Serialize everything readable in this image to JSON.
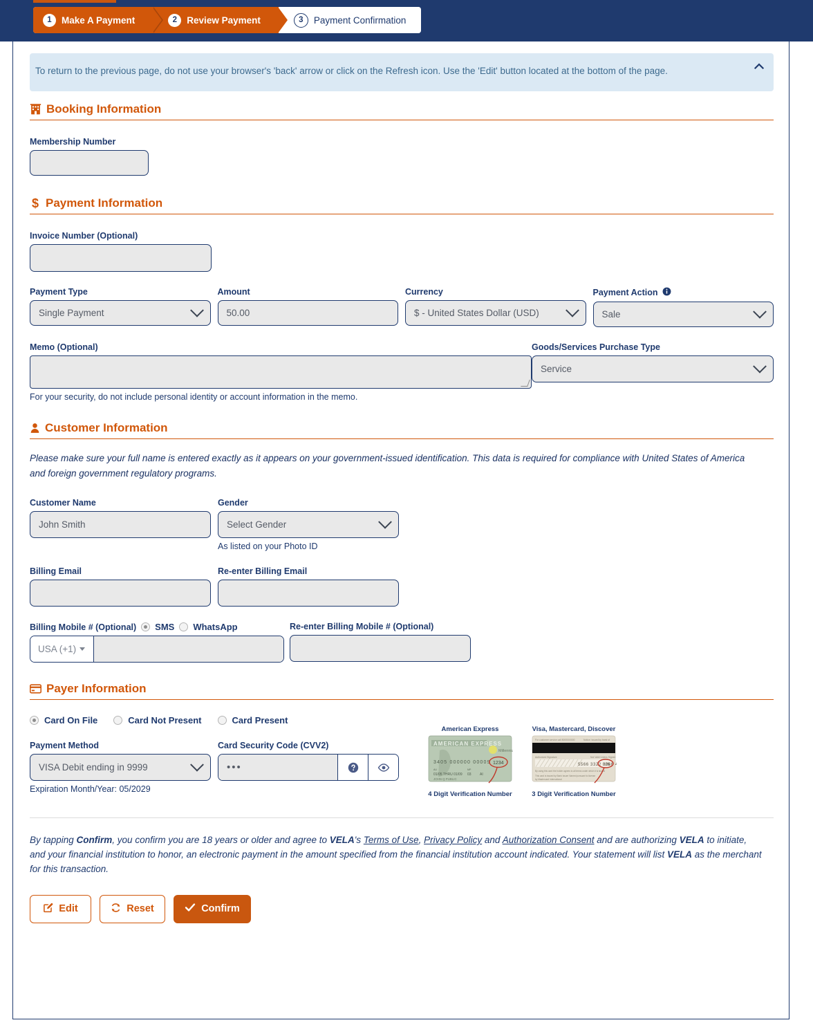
{
  "wizard": {
    "steps": [
      {
        "num": "1",
        "label": "Make A Payment",
        "state": "done"
      },
      {
        "num": "2",
        "label": "Review Payment",
        "state": "done"
      },
      {
        "num": "3",
        "label": "Payment Confirmation",
        "state": "current"
      }
    ]
  },
  "alert": {
    "text": "To return to the previous page, do not use your browser's 'back' arrow or click on the Refresh icon. Use the 'Edit' button located at the bottom of the page.",
    "collapse_icon": "chevron-up-icon"
  },
  "booking": {
    "heading": "Booking Information",
    "icon": "building-icon",
    "membership_label": "Membership Number",
    "membership_value": ""
  },
  "payment": {
    "heading": "Payment Information",
    "icon": "dollar-icon",
    "invoice_label": "Invoice Number (Optional)",
    "invoice_value": "",
    "payment_type_label": "Payment Type",
    "payment_type_value": "Single Payment",
    "amount_label": "Amount",
    "amount_value": "50.00",
    "currency_label": "Currency",
    "currency_value": "$ - United States Dollar (USD)",
    "payment_action_label": "Payment Action",
    "payment_action_info_icon": "info-icon",
    "payment_action_value": "Sale",
    "memo_label": "Memo (Optional)",
    "memo_value": "",
    "memo_hint": "For your security, do not include personal identity or account information in the memo.",
    "goods_label": "Goods/Services Purchase Type",
    "goods_value": "Service"
  },
  "customer": {
    "heading": "Customer Information",
    "icon": "person-icon",
    "notice": "Please make sure your full name is entered exactly as it appears on your government-issued identification. This data is required for compliance with United States of America and foreign government regulatory programs.",
    "name_label": "Customer Name",
    "name_value": "John Smith",
    "gender_label": "Gender",
    "gender_value": "Select Gender",
    "gender_hint": "As listed on your Photo ID",
    "email_label": "Billing Email",
    "email_value": "",
    "email_confirm_label": "Re-enter Billing Email",
    "email_confirm_value": "",
    "mobile_label": "Billing Mobile # (Optional)",
    "mobile_sms_label": "SMS",
    "mobile_whatsapp_label": "WhatsApp",
    "mobile_country": "USA (+1)",
    "mobile_value": "",
    "mobile_confirm_label": "Re-enter Billing Mobile # (Optional)",
    "mobile_confirm_value": ""
  },
  "payer": {
    "heading": "Payer Information",
    "icon": "credit-card-icon",
    "options": [
      {
        "label": "Card On File",
        "selected": true
      },
      {
        "label": "Card Not Present",
        "selected": false
      },
      {
        "label": "Card Present",
        "selected": false
      }
    ],
    "method_label": "Payment Method",
    "method_value": "VISA Debit ending in 9999",
    "expiration": "Expiration Month/Year: 05/2029",
    "cvv_label": "Card Security Code (CVV2)",
    "cvv_value": "•••",
    "cvv_help_icon": "question-circle-icon",
    "cvv_eye_icon": "eye-icon",
    "amex_title": "American Express",
    "amex_caption": "4 Digit Verification Number",
    "amex_digits": "1234",
    "other_title": "Visa, Mastercard, Discover",
    "other_caption": "3 Digit Verification Number"
  },
  "footer": {
    "terms_1": "By tapping ",
    "terms_confirm": "Confirm",
    "terms_2": ", you confirm you are 18 years or older and agree to ",
    "brand": "VELA",
    "terms_3": "'s ",
    "link_terms": "Terms of Use",
    "terms_4": ", ",
    "link_privacy": "Privacy Policy",
    "terms_5": " and ",
    "link_auth": "Authorization Consent",
    "terms_6": " and are authorizing ",
    "terms_7": " to initiate, and your financial institution to honor, an electronic payment in the amount specified from the financial institution account indicated. Your statement will list ",
    "terms_8": " as the merchant for this transaction.",
    "edit_label": "Edit",
    "edit_icon": "edit-square-icon",
    "reset_label": "Reset",
    "reset_icon": "refresh-icon",
    "confirm_label": "Confirm",
    "confirm_icon": "check-icon"
  },
  "colors": {
    "navy": "#1f3a6e",
    "orange": "#d1570a",
    "orange_dark": "#c9570f",
    "alert_bg": "#dbe9f4",
    "field_bg": "#e9e9e9"
  }
}
